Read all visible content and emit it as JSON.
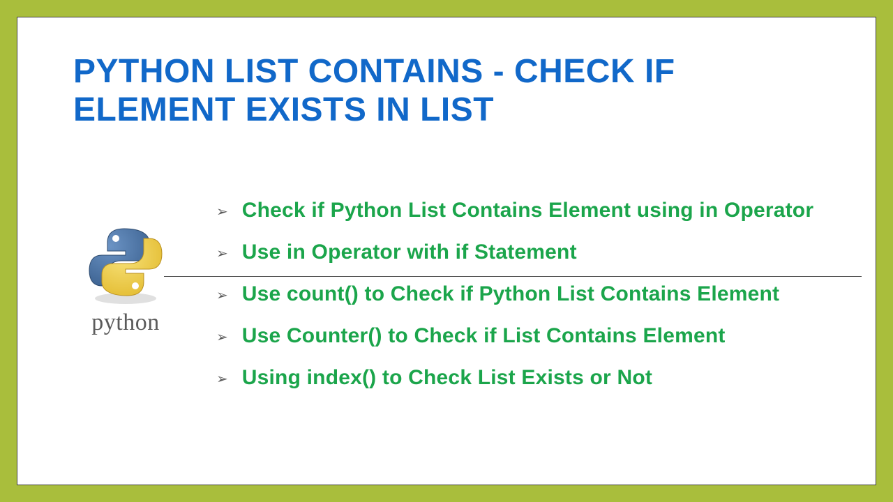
{
  "title": "PYTHON LIST CONTAINS - CHECK IF ELEMENT EXISTS IN LIST",
  "logo_text": "python",
  "items": [
    "Check if Python List Contains Element using in Operator",
    "Use in Operator with if Statement",
    "Use count() to Check if Python List Contains Element",
    "Use Counter() to Check if List Contains Element",
    "Using index() to Check List Exists or Not"
  ]
}
